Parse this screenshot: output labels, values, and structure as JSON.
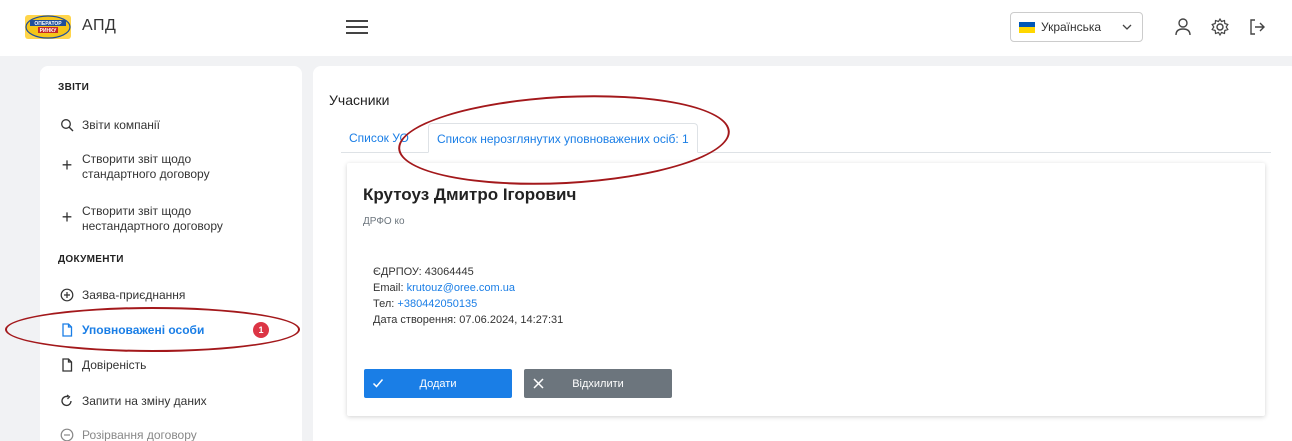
{
  "header": {
    "logo_text": "ОПЕРАТОР РИНКУ",
    "app_title": "АПД",
    "language": "Українська"
  },
  "sidebar": {
    "section_reports": "ЗВІТИ",
    "reports_items": [
      {
        "label": "Звіти компанії",
        "icon": "search-icon"
      },
      {
        "label_line1": "Створити звіт щодо",
        "label_line2": "стандартного договору",
        "icon": "plus-icon"
      },
      {
        "label_line1": "Створити звіт щодо",
        "label_line2": "нестандартного договору",
        "icon": "plus-icon"
      }
    ],
    "section_documents": "ДОКУМЕНТИ",
    "document_items": [
      {
        "label": "Заява-приєднання",
        "icon": "plus-circle-icon"
      },
      {
        "label": "Уповноважені особи",
        "icon": "file-icon",
        "badge": "1"
      },
      {
        "label": "Довіреність",
        "icon": "file-icon"
      },
      {
        "label": "Запити на зміну даних",
        "icon": "refresh-icon"
      },
      {
        "label": "Розірвання договору",
        "icon": "minus-circle-icon"
      }
    ]
  },
  "main": {
    "title": "Учасники",
    "tabs": [
      {
        "label": "Список УО"
      },
      {
        "label": "Список нерозглянутих уповноважених осіб: 1"
      }
    ],
    "card": {
      "name": "Крутоуз Дмитро Ігорович",
      "drfo": "ДРФО ко",
      "edrpou_label": "ЄДРПОУ:",
      "edrpou_value": "43064445",
      "email_label": "Email:",
      "email_value": "krutouz@oree.com.ua",
      "phone_label": "Тел:",
      "phone_value": "+380442050135",
      "created_label": "Дата створення:",
      "created_value": "07.06.2024, 14:27:31",
      "add_button": "Додати",
      "reject_button": "Відхилити"
    }
  },
  "colors": {
    "primary": "#1a7ee6",
    "secondary": "#6c757d",
    "danger": "#dc3545",
    "annotation": "#a3181b"
  }
}
